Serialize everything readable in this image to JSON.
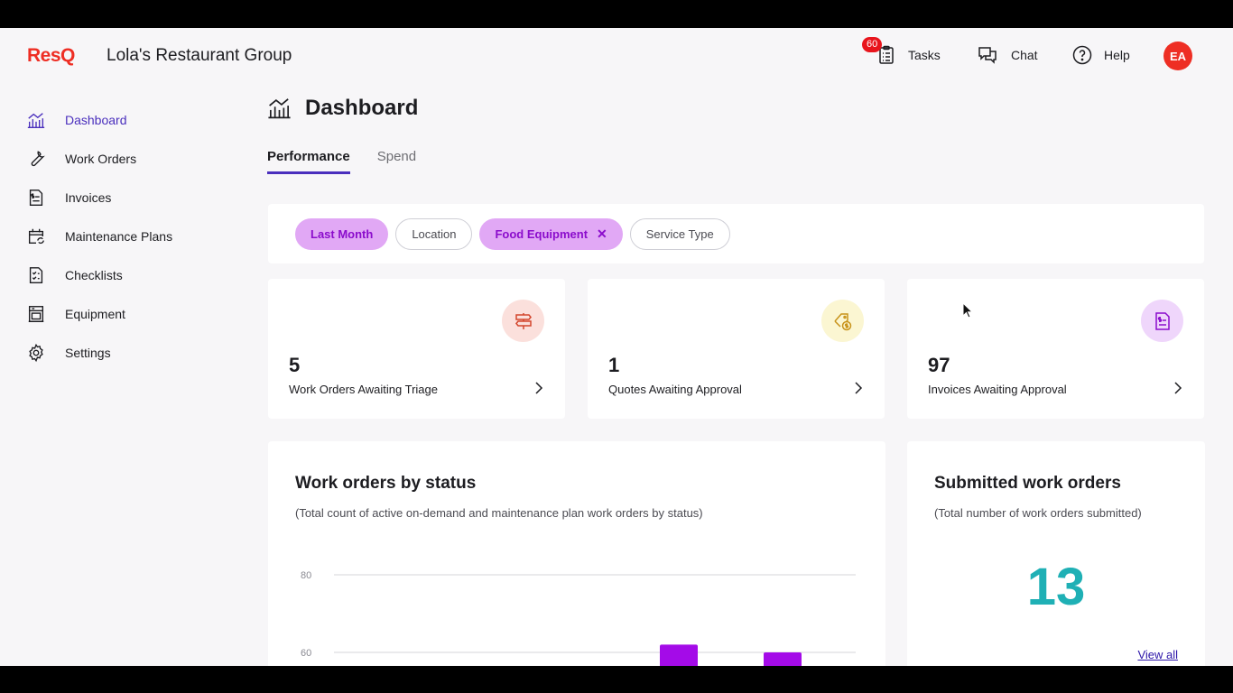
{
  "header": {
    "logo": "ResQ",
    "org_name": "Lola's Restaurant Group",
    "tasks_label": "Tasks",
    "tasks_badge": "60",
    "chat_label": "Chat",
    "help_label": "Help",
    "avatar_initials": "EA"
  },
  "sidebar": {
    "items": [
      {
        "label": "Dashboard",
        "icon": "dashboard-icon",
        "active": true
      },
      {
        "label": "Work Orders",
        "icon": "wrench-icon"
      },
      {
        "label": "Invoices",
        "icon": "invoice-icon"
      },
      {
        "label": "Maintenance Plans",
        "icon": "calendar-refresh-icon"
      },
      {
        "label": "Checklists",
        "icon": "checklist-icon"
      },
      {
        "label": "Equipment",
        "icon": "equipment-icon"
      },
      {
        "label": "Settings",
        "icon": "gear-icon"
      }
    ]
  },
  "page": {
    "title": "Dashboard",
    "tabs": [
      {
        "label": "Performance",
        "active": true
      },
      {
        "label": "Spend"
      }
    ]
  },
  "filters": [
    {
      "label": "Last Month",
      "selected": true
    },
    {
      "label": "Location",
      "selected": false
    },
    {
      "label": "Food Equipment",
      "selected": true,
      "removable": true
    },
    {
      "label": "Service Type",
      "selected": false
    }
  ],
  "stats": [
    {
      "value": "5",
      "label": "Work Orders Awaiting Triage",
      "icon": "signpost-icon",
      "color": "#fbe0dc"
    },
    {
      "value": "1",
      "label": "Quotes Awaiting Approval",
      "icon": "price-tag-icon",
      "color": "#fbf6d2"
    },
    {
      "value": "97",
      "label": "Invoices Awaiting Approval",
      "icon": "invoice-dollar-icon",
      "color": "#efd6fb"
    }
  ],
  "work_orders_card": {
    "title": "Work orders by status",
    "subtitle": "(Total count of active on-demand and maintenance plan work orders by status)"
  },
  "submitted_card": {
    "title": "Submitted work orders",
    "subtitle": "(Total number of work orders submitted)",
    "value": "13",
    "link": "View all"
  },
  "chart_data": {
    "type": "bar",
    "title": "Work orders by status",
    "yticks": [
      "80",
      "60"
    ],
    "ylim": [
      0,
      80
    ],
    "series": [
      {
        "values": [
          62,
          60
        ]
      }
    ],
    "color": "#a40be8"
  },
  "colors": {
    "brand": "#ee2e24",
    "accent": "#4a2fbd",
    "chip_selected_bg": "#e1a8f5",
    "chip_selected_text": "#8b0ccc",
    "big_number": "#1fb0b5"
  }
}
